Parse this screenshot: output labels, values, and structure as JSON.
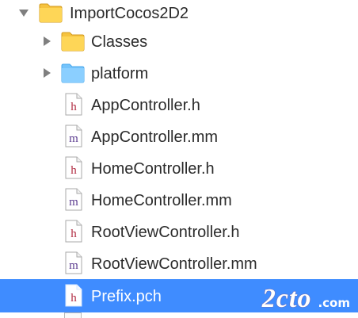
{
  "project_navigator": {
    "items": [
      {
        "label": "ImportCocos2D2",
        "kind": "folder",
        "icon": "folder-icon",
        "color": "#f6c33f"
      },
      {
        "label": "Classes",
        "kind": "folder",
        "icon": "folder-icon",
        "color": "#f6c33f"
      },
      {
        "label": "platform",
        "kind": "folder",
        "icon": "folder-icon",
        "color": "#8cd0ff"
      },
      {
        "label": "AppController.h",
        "kind": "header-file",
        "icon": "header-file-icon",
        "badge": "h"
      },
      {
        "label": "AppController.mm",
        "kind": "implementation-file",
        "icon": "implementation-file-icon",
        "badge": "m"
      },
      {
        "label": "HomeController.h",
        "kind": "header-file",
        "icon": "header-file-icon",
        "badge": "h"
      },
      {
        "label": "HomeController.mm",
        "kind": "implementation-file",
        "icon": "implementation-file-icon",
        "badge": "m"
      },
      {
        "label": "RootViewController.h",
        "kind": "header-file",
        "icon": "header-file-icon",
        "badge": "h"
      },
      {
        "label": "RootViewController.mm",
        "kind": "implementation-file",
        "icon": "implementation-file-icon",
        "badge": "m"
      },
      {
        "label": "Prefix.pch",
        "kind": "header-file",
        "icon": "header-file-icon",
        "badge": "h",
        "selected": true
      }
    ]
  },
  "watermark": {
    "main": "2cto",
    "suffix": ".com"
  },
  "colors": {
    "selection": "#3f8cff",
    "header_badge": "#b12b42",
    "implementation_badge": "#5b3b8f",
    "folder_yellow": "#f6c33f",
    "folder_blue": "#8cd0ff"
  }
}
